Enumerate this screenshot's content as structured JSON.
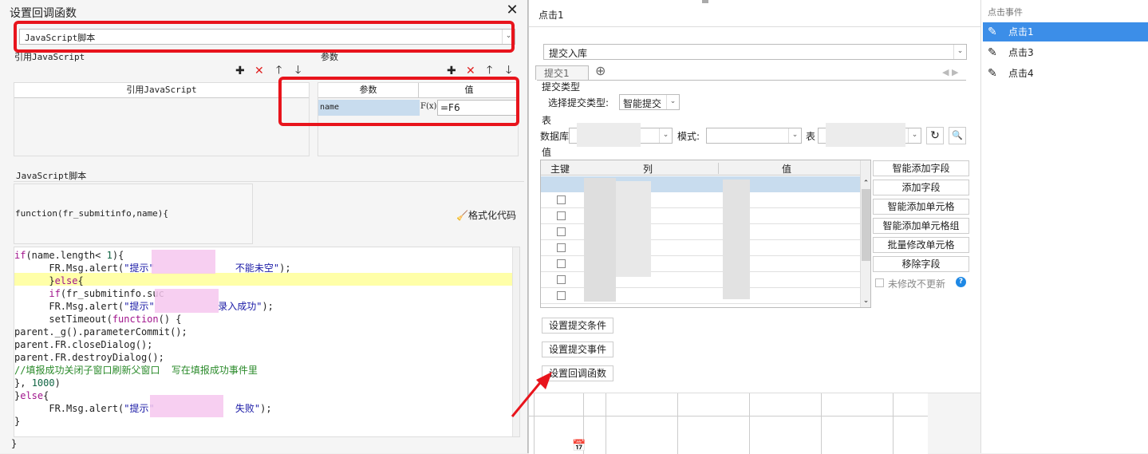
{
  "dialog": {
    "title": "设置回调函数",
    "close": "✕",
    "script_type": "JavaScript脚本",
    "ref_js_label": "引用JavaScript",
    "params_label": "参数",
    "ref_js_header": "引用JavaScript",
    "param_col": "参数",
    "value_col": "值",
    "param_row": {
      "name": "name",
      "fx": "F(x)",
      "value": "=F6"
    },
    "script_section_label": "JavaScript脚本",
    "function_sig": "function(fr_submitinfo,name){",
    "format_code": "格式化代码",
    "closing_brace": "}",
    "code_lines": [
      {
        "parts": [
          [
            "kw",
            "if"
          ],
          [
            "",
            "(name.length< "
          ],
          [
            "num",
            "1"
          ],
          [
            "",
            "){"
          ]
        ]
      },
      {
        "parts": [
          [
            "",
            "      FR.Msg.alert("
          ],
          [
            "str",
            "\"提示\""
          ],
          [
            "",
            "              "
          ],
          [
            "str",
            "不能未空\""
          ],
          [
            "",
            ");"
          ]
        ]
      },
      {
        "parts": [
          [
            "",
            "      }"
          ],
          [
            "kw",
            "else"
          ],
          [
            "",
            "{"
          ]
        ]
      },
      {
        "parts": [
          [
            "",
            "      "
          ],
          [
            "kw",
            "if"
          ],
          [
            "",
            "(fr_submitinfo.suc"
          ]
        ]
      },
      {
        "parts": [
          [
            "",
            "      FR.Msg.alert("
          ],
          [
            "str",
            "\"提示\""
          ],
          [
            "",
            "           "
          ],
          [
            "str",
            "录入成功\""
          ],
          [
            "",
            ");"
          ]
        ]
      },
      {
        "parts": [
          [
            "",
            "      setTimeout("
          ],
          [
            "kw",
            "function"
          ],
          [
            "",
            "() {"
          ]
        ]
      },
      {
        "parts": [
          [
            "",
            "parent._g().parameterCommit();"
          ]
        ]
      },
      {
        "parts": [
          [
            "",
            "parent.FR.closeDialog();"
          ]
        ]
      },
      {
        "parts": [
          [
            "",
            "parent.FR.destroyDialog();"
          ]
        ]
      },
      {
        "parts": [
          [
            "cm",
            "//填报成功关闭子窗口刷新父窗口  写在填报成功事件里"
          ]
        ]
      },
      {
        "parts": [
          [
            "",
            "}, "
          ],
          [
            "num",
            "1000"
          ],
          [
            "",
            ")"
          ]
        ]
      },
      {
        "parts": [
          [
            "",
            "}"
          ],
          [
            "kw",
            "else"
          ],
          [
            "",
            "{"
          ]
        ]
      },
      {
        "parts": [
          [
            "",
            "      FR.Msg.alert("
          ],
          [
            "str",
            "\"提示\""
          ],
          [
            "",
            "              "
          ],
          [
            "str",
            "失败\""
          ],
          [
            "",
            ");"
          ]
        ]
      },
      {
        "parts": [
          [
            "",
            "}"
          ]
        ]
      }
    ]
  },
  "middle": {
    "title": "点击1",
    "action": "提交入库",
    "tab": "提交1",
    "submit_type_label": "提交类型",
    "select_submit_type_label": "选择提交类型:",
    "submit_type_value": "智能提交",
    "table_section": "表",
    "db_label": "数据库",
    "mode_label": "模式:",
    "table_label": "表",
    "value_section": "值",
    "grid_headers": [
      "主键",
      "列",
      "值"
    ],
    "side_buttons": [
      "智能添加字段",
      "添加字段",
      "智能添加单元格",
      "智能添加单元格组",
      "批量修改单元格",
      "移除字段"
    ],
    "no_update_label": "未修改不更新",
    "bottom_buttons": [
      "设置提交条件",
      "设置提交事件",
      "设置回调函数"
    ]
  },
  "right": {
    "header": "点击事件",
    "items": [
      "点击1",
      "点击3",
      "点击4"
    ],
    "selected_index": 0
  },
  "colors": {
    "accent": "#3c8ee8",
    "annotation": "#e8141c",
    "highlight": "#ffffa8"
  }
}
